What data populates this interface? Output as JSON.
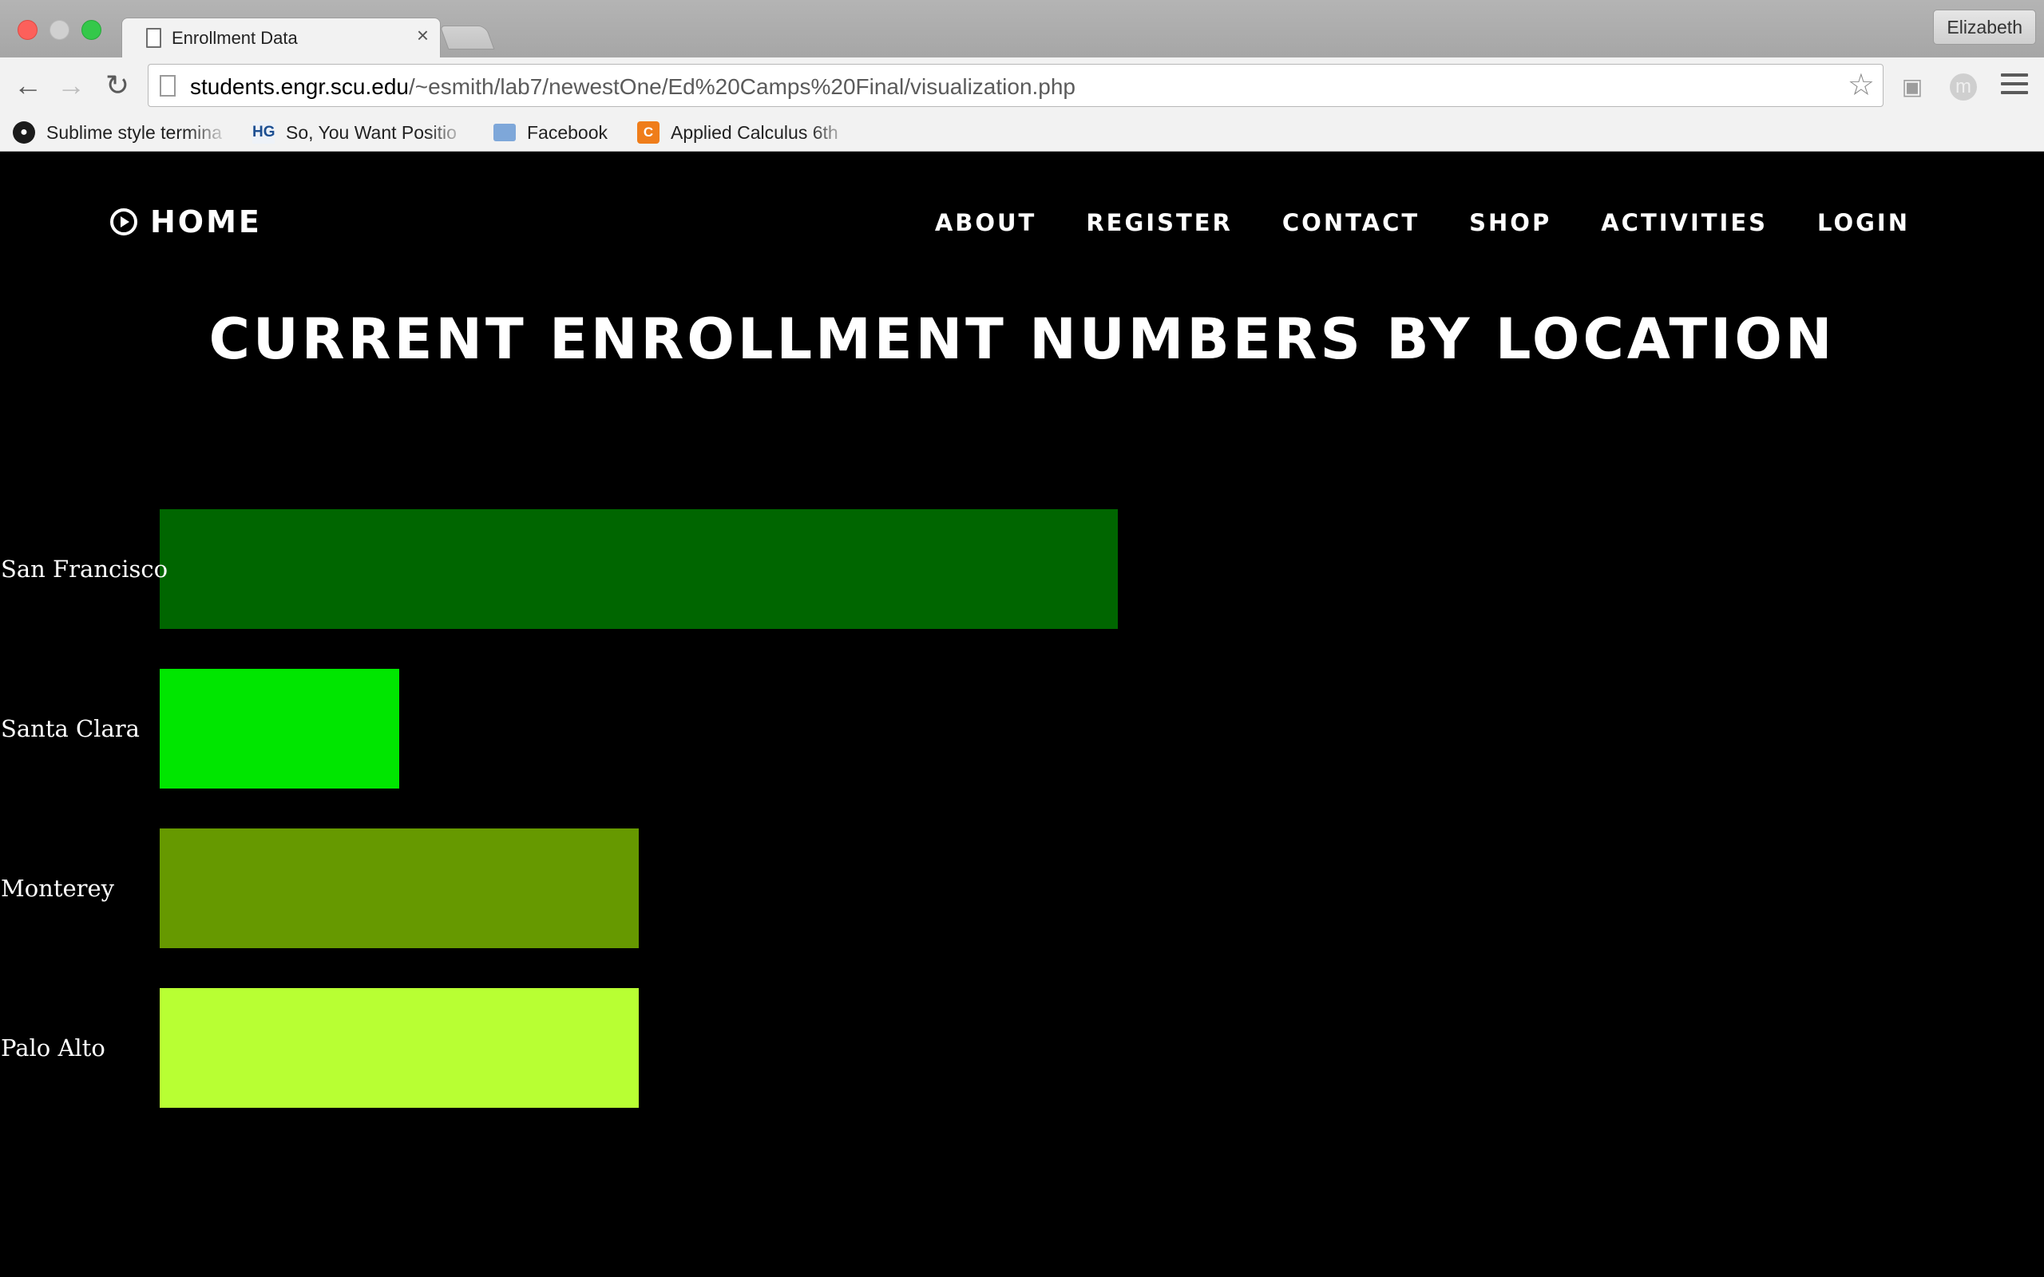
{
  "browser": {
    "tab_title": "Enrollment Data",
    "tab_close": "×",
    "profile_name": "Elizabeth",
    "url_host": "students.engr.scu.edu",
    "url_path": "/~esmith/lab7/newestOne/Ed%20Camps%20Final/visualization.php",
    "nav_icons": {
      "back": "←",
      "forward": "→",
      "reload": "↻",
      "star": "☆"
    },
    "bookmarks": [
      {
        "label": "Sublime style termina",
        "icon": "github-icon",
        "glyph": "●"
      },
      {
        "label": "So, You Want Positio",
        "icon": "hg-icon",
        "glyph": "HG"
      },
      {
        "label": "Facebook",
        "icon": "folder-icon",
        "glyph": ""
      },
      {
        "label": "Applied Calculus 6th",
        "icon": "chegg-icon",
        "glyph": "C"
      }
    ]
  },
  "site": {
    "home_label": "HOME",
    "menu": [
      "ABOUT",
      "REGISTER",
      "CONTACT",
      "SHOP",
      "ACTIVITIES",
      "LOGIN"
    ],
    "heading": "CURRENT ENROLLMENT NUMBERS BY LOCATION"
  },
  "chart_data": {
    "type": "bar",
    "orientation": "horizontal",
    "title": "CURRENT ENROLLMENT NUMBERS BY LOCATION",
    "categories": [
      "San Francisco",
      "Santa Clara",
      "Monterey",
      "Palo Alto"
    ],
    "values": [
      8,
      2,
      4,
      4
    ],
    "colors": [
      "#006600",
      "#00e600",
      "#669900",
      "#b8ff33"
    ],
    "xlabel": "",
    "ylabel": "",
    "grid": false,
    "legend": "none"
  }
}
